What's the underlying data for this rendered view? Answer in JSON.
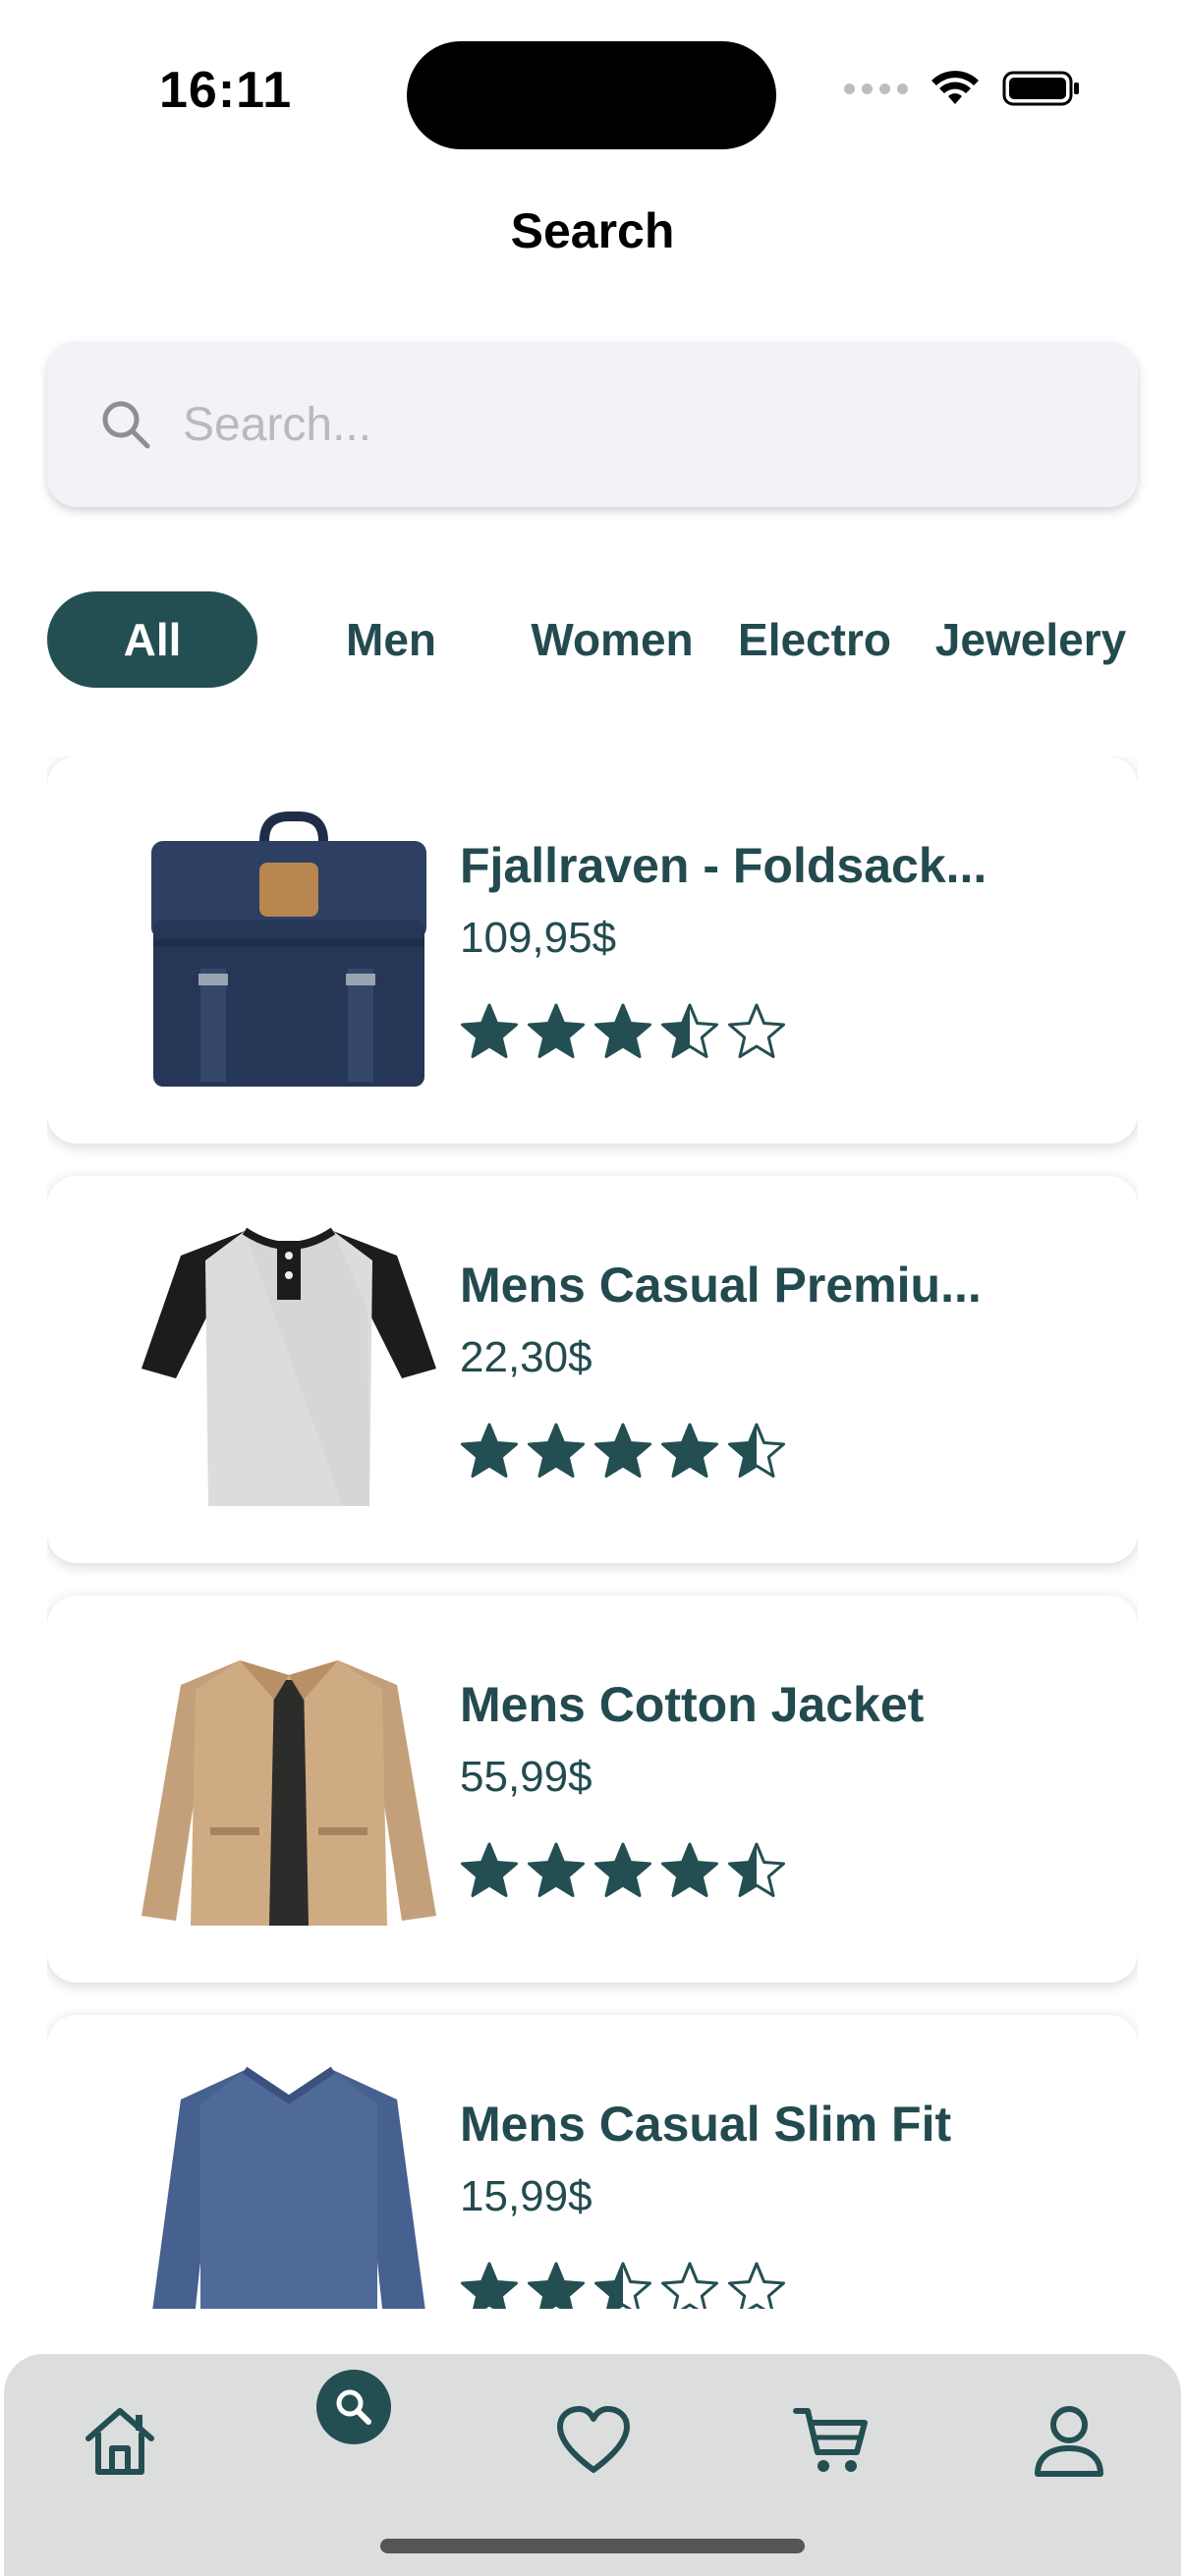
{
  "status_bar": {
    "time": "16:11"
  },
  "header": {
    "title": "Search"
  },
  "search": {
    "placeholder": "Search...",
    "value": ""
  },
  "categories": [
    {
      "label": "All",
      "active": true
    },
    {
      "label": "Men",
      "active": false
    },
    {
      "label": "Women",
      "active": false
    },
    {
      "label": "Electro",
      "active": false
    },
    {
      "label": "Jewelery",
      "active": false
    }
  ],
  "products": [
    {
      "title": "Fjallraven - Foldsack...",
      "price": "109,95$",
      "rating": 3.5,
      "image": "backpack"
    },
    {
      "title": "Mens Casual Premiu...",
      "price": "22,30$",
      "rating": 4.5,
      "image": "raglan-tshirt"
    },
    {
      "title": "Mens Cotton Jacket",
      "price": "55,99$",
      "rating": 4.5,
      "image": "cotton-jacket"
    },
    {
      "title": "Mens Casual Slim Fit",
      "price": "15,99$",
      "rating": 2.5,
      "image": "longsleeve-shirt"
    }
  ],
  "tabbar": {
    "items": [
      {
        "icon": "home-icon",
        "active": false
      },
      {
        "icon": "search-icon",
        "active": true
      },
      {
        "icon": "heart-icon",
        "active": false
      },
      {
        "icon": "cart-icon",
        "active": false
      },
      {
        "icon": "profile-icon",
        "active": false
      }
    ]
  },
  "colors": {
    "accent": "#234f52",
    "text": "#234b4f",
    "search_bg": "#f2f2f7",
    "tabbar_bg": "#dcdede"
  }
}
